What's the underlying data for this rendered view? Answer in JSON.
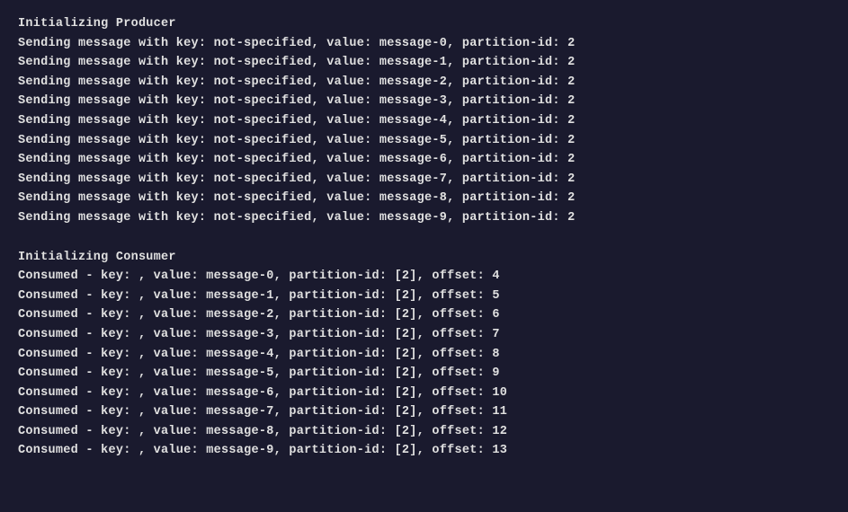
{
  "terminal": {
    "background": "#1a1a2e",
    "lines": [
      "Initializing Producer",
      "Sending message with key: not-specified, value: message-0, partition-id: 2",
      "Sending message with key: not-specified, value: message-1, partition-id: 2",
      "Sending message with key: not-specified, value: message-2, partition-id: 2",
      "Sending message with key: not-specified, value: message-3, partition-id: 2",
      "Sending message with key: not-specified, value: message-4, partition-id: 2",
      "Sending message with key: not-specified, value: message-5, partition-id: 2",
      "Sending message with key: not-specified, value: message-6, partition-id: 2",
      "Sending message with key: not-specified, value: message-7, partition-id: 2",
      "Sending message with key: not-specified, value: message-8, partition-id: 2",
      "Sending message with key: not-specified, value: message-9, partition-id: 2",
      "",
      "Initializing Consumer",
      "Consumed - key: , value: message-0, partition-id: [2], offset: 4",
      "Consumed - key: , value: message-1, partition-id: [2], offset: 5",
      "Consumed - key: , value: message-2, partition-id: [2], offset: 6",
      "Consumed - key: , value: message-3, partition-id: [2], offset: 7",
      "Consumed - key: , value: message-4, partition-id: [2], offset: 8",
      "Consumed - key: , value: message-5, partition-id: [2], offset: 9",
      "Consumed - key: , value: message-6, partition-id: [2], offset: 10",
      "Consumed - key: , value: message-7, partition-id: [2], offset: 11",
      "Consumed - key: , value: message-8, partition-id: [2], offset: 12",
      "Consumed - key: , value: message-9, partition-id: [2], offset: 13"
    ]
  }
}
